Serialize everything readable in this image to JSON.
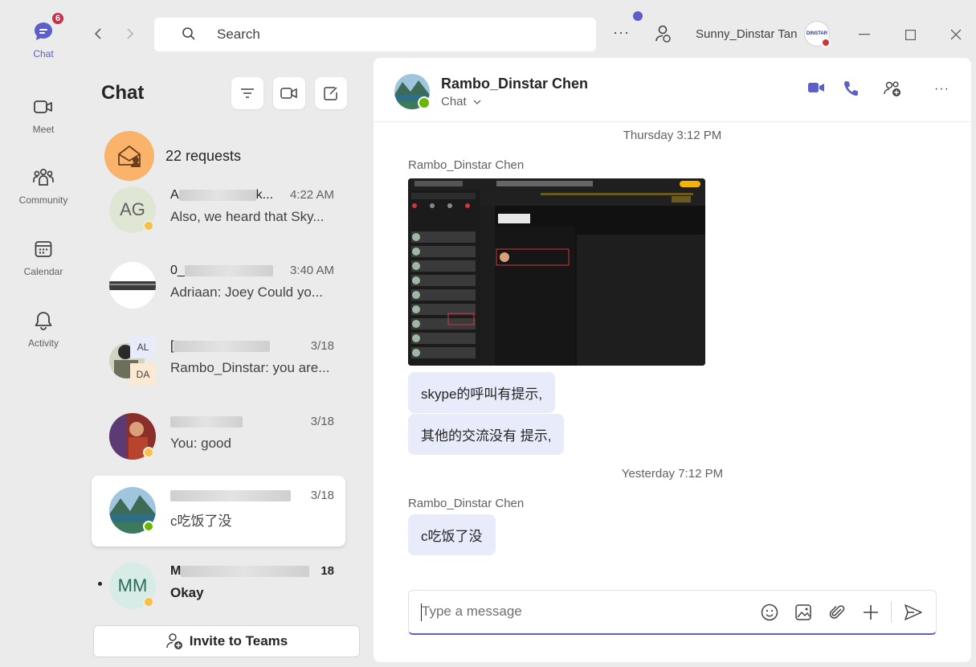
{
  "rail": {
    "items": [
      {
        "label": "Chat",
        "badge": "6",
        "icon": "chat-icon"
      },
      {
        "label": "Meet",
        "icon": "video-camera-icon"
      },
      {
        "label": "Community",
        "icon": "community-icon"
      },
      {
        "label": "Calendar",
        "icon": "calendar-icon"
      },
      {
        "label": "Activity",
        "icon": "bell-icon"
      }
    ]
  },
  "titlebar": {
    "search_placeholder": "Search",
    "more": "···",
    "user_name": "Sunny_Dinstar Tan",
    "avatar_text": "DINSTAR"
  },
  "chatlist": {
    "title": "Chat",
    "requests_label": "22 requests",
    "items": [
      {
        "initials": "AG",
        "name_start": "A",
        "name_end": "k...",
        "time": "4:22 AM",
        "preview": "Also, we heard that Sky...",
        "status": "away"
      },
      {
        "initials": "",
        "name_start": "0_",
        "name_end": "",
        "time": "3:40 AM",
        "preview": "Adriaan: Joey Could yo...",
        "status": ""
      },
      {
        "initials": "AL DA",
        "name_start": "[",
        "name_end": "",
        "time": "3/18",
        "preview": "Rambo_Dinstar: you are...",
        "status": ""
      },
      {
        "initials": "",
        "name_start": "",
        "name_end": "",
        "time": "3/18",
        "preview": "You: good",
        "status": "away"
      },
      {
        "initials": "",
        "name_start": "",
        "name_end": "",
        "time": "3/18",
        "preview": "c吃饭了没",
        "status": "online"
      },
      {
        "initials": "MM",
        "name_start": "M",
        "name_end": "",
        "time": "18",
        "preview": "Okay",
        "status": "away"
      }
    ],
    "av3_top": "AL",
    "av3_bottom": "DA",
    "invite_label": "Invite to Teams"
  },
  "conversation": {
    "contact_name": "Rambo_Dinstar Chen",
    "contact_sub": "Chat",
    "messages": [
      {
        "type": "time",
        "text": "Thursday 3:12 PM"
      },
      {
        "type": "sender",
        "text": "Rambo_Dinstar Chen"
      },
      {
        "type": "text",
        "text": "skype的呼叫有提示,"
      },
      {
        "type": "text",
        "text": "其他的交流没有 提示,"
      },
      {
        "type": "time",
        "text": "Yesterday 7:12 PM"
      },
      {
        "type": "sender",
        "text": "Rambo_Dinstar Chen"
      },
      {
        "type": "text",
        "text": "c吃饭了没"
      }
    ],
    "composer_placeholder": "Type a message"
  },
  "colors": {
    "accent": "#5b5fc7",
    "bubble": "#e8ebfa",
    "away": "#f8c240",
    "online": "#6bb700",
    "badge": "#c4314b",
    "requests": "#f9b36a"
  }
}
